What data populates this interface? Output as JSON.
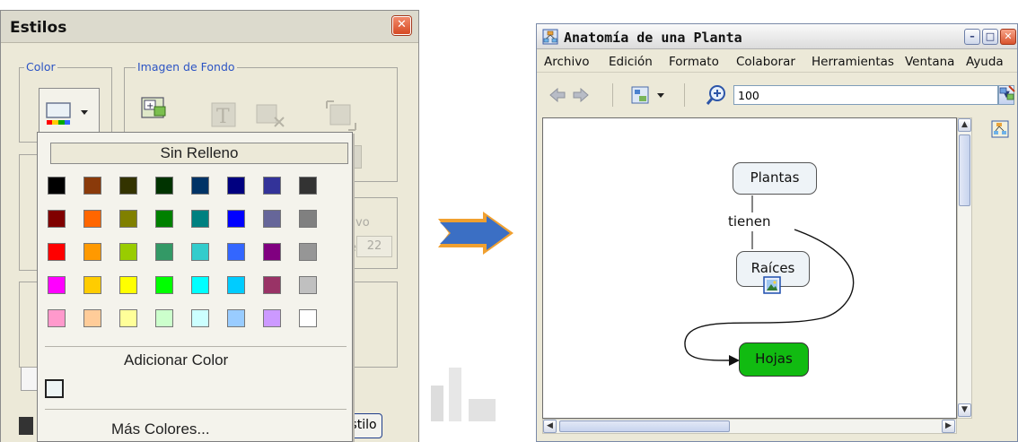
{
  "estilos": {
    "title": "Estilos",
    "color_group_label": "Color",
    "imagen_group_label": "Imagen de Fondo",
    "faded_label": "vo",
    "faded_value": "22",
    "estilo_button_label": "stilo"
  },
  "color_popup": {
    "sin_relleno_label": "Sin Relleno",
    "adicionar_label": "Adicionar Color",
    "mas_colores_label": "Más Colores...",
    "swatch_rows": [
      [
        "#000000",
        "#8a3a0a",
        "#333300",
        "#003300",
        "#003366",
        "#000080",
        "#333399",
        "#333333"
      ],
      [
        "#800000",
        "#ff6600",
        "#808000",
        "#008000",
        "#008080",
        "#0000ff",
        "#666699",
        "#808080"
      ],
      [
        "#ff0000",
        "#ff9900",
        "#99cc00",
        "#339966",
        "#33cccc",
        "#3366ff",
        "#800080",
        "#969696"
      ],
      [
        "#ff00ff",
        "#ffcc00",
        "#ffff00",
        "#00ff00",
        "#00ffff",
        "#00ccff",
        "#993366",
        "#c0c0c0"
      ],
      [
        "#ff99cc",
        "#ffcc99",
        "#ffff99",
        "#ccffcc",
        "#ccffff",
        "#99ccff",
        "#cc99ff",
        "#ffffff"
      ]
    ],
    "custom_color": "#eef5f5"
  },
  "cmap_window": {
    "title": "Anatomía de una Planta",
    "menu": [
      "Archivo",
      "Edición",
      "Formato",
      "Colaborar",
      "Herramientas",
      "Ventana",
      "Ayuda"
    ],
    "zoom_value": "100",
    "concepts": {
      "plantas": "Plantas",
      "raices": "Raíces",
      "hojas": "Hojas"
    },
    "link_phrase": "tienen",
    "hojas_color": "#11bb11"
  },
  "colors": {
    "group_label_blue": "#2c54c4",
    "arrow_fill": "#3b6fc4",
    "arrow_accent": "#f0a030"
  }
}
